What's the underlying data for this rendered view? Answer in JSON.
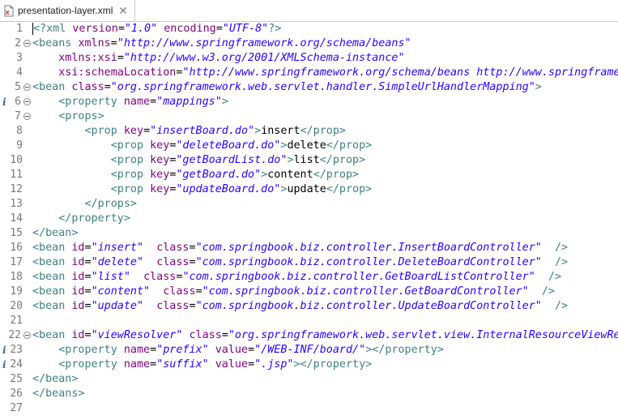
{
  "tab": {
    "title": "presentation-layer.xml",
    "file_icon": "xml-file-icon",
    "close_icon": "close-icon"
  },
  "colors": {
    "tag": "#3f7f7f",
    "attribute": "#7f007f",
    "value": "#2a00ff",
    "text": "#000000",
    "line_number": "#787878"
  },
  "lines": [
    {
      "n": "1",
      "fold": false,
      "info": false,
      "tokens": [
        [
          "pi",
          "<?xml "
        ],
        [
          "attr",
          "version"
        ],
        [
          "txt",
          "="
        ],
        [
          "val",
          "\"1.0\""
        ],
        [
          "txt",
          " "
        ],
        [
          "attr",
          "encoding"
        ],
        [
          "txt",
          "="
        ],
        [
          "val",
          "\"UTF-8\""
        ],
        [
          "pi",
          "?>"
        ]
      ]
    },
    {
      "n": "2",
      "fold": true,
      "info": false,
      "tokens": [
        [
          "tag",
          "<beans "
        ],
        [
          "attr",
          "xmlns"
        ],
        [
          "txt",
          "="
        ],
        [
          "val",
          "\"http://www.springframework.org/schema/beans\""
        ]
      ]
    },
    {
      "n": "3",
      "fold": false,
      "info": false,
      "tokens": [
        [
          "txt",
          "    "
        ],
        [
          "attr",
          "xmlns:xsi"
        ],
        [
          "txt",
          "="
        ],
        [
          "val",
          "\"http://www.w3.org/2001/XMLSchema-instance\""
        ]
      ]
    },
    {
      "n": "4",
      "fold": false,
      "info": false,
      "tokens": [
        [
          "txt",
          "    "
        ],
        [
          "attr",
          "xsi:schemaLocation"
        ],
        [
          "txt",
          "="
        ],
        [
          "val",
          "\"http://www.springframework.org/schema/beans http://www.springframe"
        ]
      ]
    },
    {
      "n": "5",
      "fold": true,
      "info": false,
      "tokens": [
        [
          "tag",
          "<bean "
        ],
        [
          "attr",
          "class"
        ],
        [
          "txt",
          "="
        ],
        [
          "val",
          "\"org.springframework.web.servlet.handler.SimpleUrlHandlerMapping\""
        ],
        [
          "tag",
          ">"
        ]
      ]
    },
    {
      "n": "6",
      "fold": true,
      "info": true,
      "tokens": [
        [
          "txt",
          "    "
        ],
        [
          "tag",
          "<property "
        ],
        [
          "attr",
          "name"
        ],
        [
          "txt",
          "="
        ],
        [
          "val",
          "\"mappings\""
        ],
        [
          "tag",
          ">"
        ]
      ]
    },
    {
      "n": "7",
      "fold": true,
      "info": false,
      "tokens": [
        [
          "txt",
          "    "
        ],
        [
          "tag",
          "<props>"
        ]
      ]
    },
    {
      "n": "8",
      "fold": false,
      "info": false,
      "tokens": [
        [
          "txt",
          "        "
        ],
        [
          "tag",
          "<prop "
        ],
        [
          "attr",
          "key"
        ],
        [
          "txt",
          "="
        ],
        [
          "val",
          "\"insertBoard.do\""
        ],
        [
          "tag",
          ">"
        ],
        [
          "txt",
          "insert"
        ],
        [
          "tag",
          "</prop>"
        ]
      ]
    },
    {
      "n": "9",
      "fold": false,
      "info": false,
      "tokens": [
        [
          "txt",
          "            "
        ],
        [
          "tag",
          "<prop "
        ],
        [
          "attr",
          "key"
        ],
        [
          "txt",
          "="
        ],
        [
          "val",
          "\"deleteBoard.do\""
        ],
        [
          "tag",
          ">"
        ],
        [
          "txt",
          "delete"
        ],
        [
          "tag",
          "</prop>"
        ]
      ]
    },
    {
      "n": "10",
      "fold": false,
      "info": false,
      "tokens": [
        [
          "txt",
          "            "
        ],
        [
          "tag",
          "<prop "
        ],
        [
          "attr",
          "key"
        ],
        [
          "txt",
          "="
        ],
        [
          "val",
          "\"getBoardList.do\""
        ],
        [
          "tag",
          ">"
        ],
        [
          "txt",
          "list"
        ],
        [
          "tag",
          "</prop>"
        ]
      ]
    },
    {
      "n": "11",
      "fold": false,
      "info": false,
      "tokens": [
        [
          "txt",
          "            "
        ],
        [
          "tag",
          "<prop "
        ],
        [
          "attr",
          "key"
        ],
        [
          "txt",
          "="
        ],
        [
          "val",
          "\"getBoard.do\""
        ],
        [
          "tag",
          ">"
        ],
        [
          "txt",
          "content"
        ],
        [
          "tag",
          "</prop>"
        ]
      ]
    },
    {
      "n": "12",
      "fold": false,
      "info": false,
      "tokens": [
        [
          "txt",
          "            "
        ],
        [
          "tag",
          "<prop "
        ],
        [
          "attr",
          "key"
        ],
        [
          "txt",
          "="
        ],
        [
          "val",
          "\"updateBoard.do\""
        ],
        [
          "tag",
          ">"
        ],
        [
          "txt",
          "update"
        ],
        [
          "tag",
          "</prop>"
        ]
      ]
    },
    {
      "n": "13",
      "fold": false,
      "info": false,
      "tokens": [
        [
          "txt",
          "        "
        ],
        [
          "tag",
          "</props>"
        ]
      ]
    },
    {
      "n": "14",
      "fold": false,
      "info": false,
      "tokens": [
        [
          "txt",
          "    "
        ],
        [
          "tag",
          "</property>"
        ]
      ]
    },
    {
      "n": "15",
      "fold": false,
      "info": false,
      "tokens": [
        [
          "tag",
          "</bean>"
        ]
      ]
    },
    {
      "n": "16",
      "fold": false,
      "info": false,
      "tokens": [
        [
          "tag",
          "<bean "
        ],
        [
          "attr",
          "id"
        ],
        [
          "txt",
          "="
        ],
        [
          "val",
          "\"insert\""
        ],
        [
          "txt",
          "  "
        ],
        [
          "attr",
          "class"
        ],
        [
          "txt",
          "="
        ],
        [
          "val",
          "\"com.springbook.biz.controller.InsertBoardController\""
        ],
        [
          "txt",
          "  "
        ],
        [
          "tag",
          "/>"
        ]
      ]
    },
    {
      "n": "17",
      "fold": false,
      "info": false,
      "tokens": [
        [
          "tag",
          "<bean "
        ],
        [
          "attr",
          "id"
        ],
        [
          "txt",
          "="
        ],
        [
          "val",
          "\"delete\""
        ],
        [
          "txt",
          "  "
        ],
        [
          "attr",
          "class"
        ],
        [
          "txt",
          "="
        ],
        [
          "val",
          "\"com.springbook.biz.controller.DeleteBoardController\""
        ],
        [
          "txt",
          "  "
        ],
        [
          "tag",
          "/>"
        ]
      ]
    },
    {
      "n": "18",
      "fold": false,
      "info": false,
      "tokens": [
        [
          "tag",
          "<bean "
        ],
        [
          "attr",
          "id"
        ],
        [
          "txt",
          "="
        ],
        [
          "val",
          "\"list\""
        ],
        [
          "txt",
          "  "
        ],
        [
          "attr",
          "class"
        ],
        [
          "txt",
          "="
        ],
        [
          "val",
          "\"com.springbook.biz.controller.GetBoardListController\""
        ],
        [
          "txt",
          "  "
        ],
        [
          "tag",
          "/>"
        ]
      ]
    },
    {
      "n": "19",
      "fold": false,
      "info": false,
      "tokens": [
        [
          "tag",
          "<bean "
        ],
        [
          "attr",
          "id"
        ],
        [
          "txt",
          "="
        ],
        [
          "val",
          "\"content\""
        ],
        [
          "txt",
          "  "
        ],
        [
          "attr",
          "class"
        ],
        [
          "txt",
          "="
        ],
        [
          "val",
          "\"com.springbook.biz.controller.GetBoardController\""
        ],
        [
          "txt",
          "  "
        ],
        [
          "tag",
          "/>"
        ]
      ]
    },
    {
      "n": "20",
      "fold": false,
      "info": false,
      "tokens": [
        [
          "tag",
          "<bean "
        ],
        [
          "attr",
          "id"
        ],
        [
          "txt",
          "="
        ],
        [
          "val",
          "\"update\""
        ],
        [
          "txt",
          "  "
        ],
        [
          "attr",
          "class"
        ],
        [
          "txt",
          "="
        ],
        [
          "val",
          "\"com.springbook.biz.controller.UpdateBoardController\""
        ],
        [
          "txt",
          "  "
        ],
        [
          "tag",
          "/>"
        ]
      ]
    },
    {
      "n": "21",
      "fold": false,
      "info": false,
      "tokens": []
    },
    {
      "n": "22",
      "fold": true,
      "info": false,
      "tokens": [
        [
          "tag",
          "<bean "
        ],
        [
          "attr",
          "id"
        ],
        [
          "txt",
          "="
        ],
        [
          "val",
          "\"viewResolver\""
        ],
        [
          "txt",
          " "
        ],
        [
          "attr",
          "class"
        ],
        [
          "txt",
          "="
        ],
        [
          "val",
          "\"org.springframework.web.servlet.view.InternalResourceViewRe"
        ]
      ]
    },
    {
      "n": "23",
      "fold": false,
      "info": true,
      "tokens": [
        [
          "txt",
          "    "
        ],
        [
          "tag",
          "<property "
        ],
        [
          "attr",
          "name"
        ],
        [
          "txt",
          "="
        ],
        [
          "val",
          "\"prefix\""
        ],
        [
          "txt",
          " "
        ],
        [
          "attr",
          "value"
        ],
        [
          "txt",
          "="
        ],
        [
          "val",
          "\"/WEB-INF/board/\""
        ],
        [
          "tag",
          "></property>"
        ]
      ]
    },
    {
      "n": "24",
      "fold": false,
      "info": true,
      "tokens": [
        [
          "txt",
          "    "
        ],
        [
          "tag",
          "<property "
        ],
        [
          "attr",
          "name"
        ],
        [
          "txt",
          "="
        ],
        [
          "val",
          "\"suffix\""
        ],
        [
          "txt",
          " "
        ],
        [
          "attr",
          "value"
        ],
        [
          "txt",
          "="
        ],
        [
          "val",
          "\".jsp\""
        ],
        [
          "tag",
          "></property>"
        ]
      ]
    },
    {
      "n": "25",
      "fold": false,
      "info": false,
      "tokens": [
        [
          "tag",
          "</bean>"
        ]
      ]
    },
    {
      "n": "26",
      "fold": false,
      "info": false,
      "tokens": [
        [
          "tag",
          "</beans>"
        ]
      ]
    },
    {
      "n": "27",
      "fold": false,
      "info": false,
      "tokens": []
    }
  ]
}
